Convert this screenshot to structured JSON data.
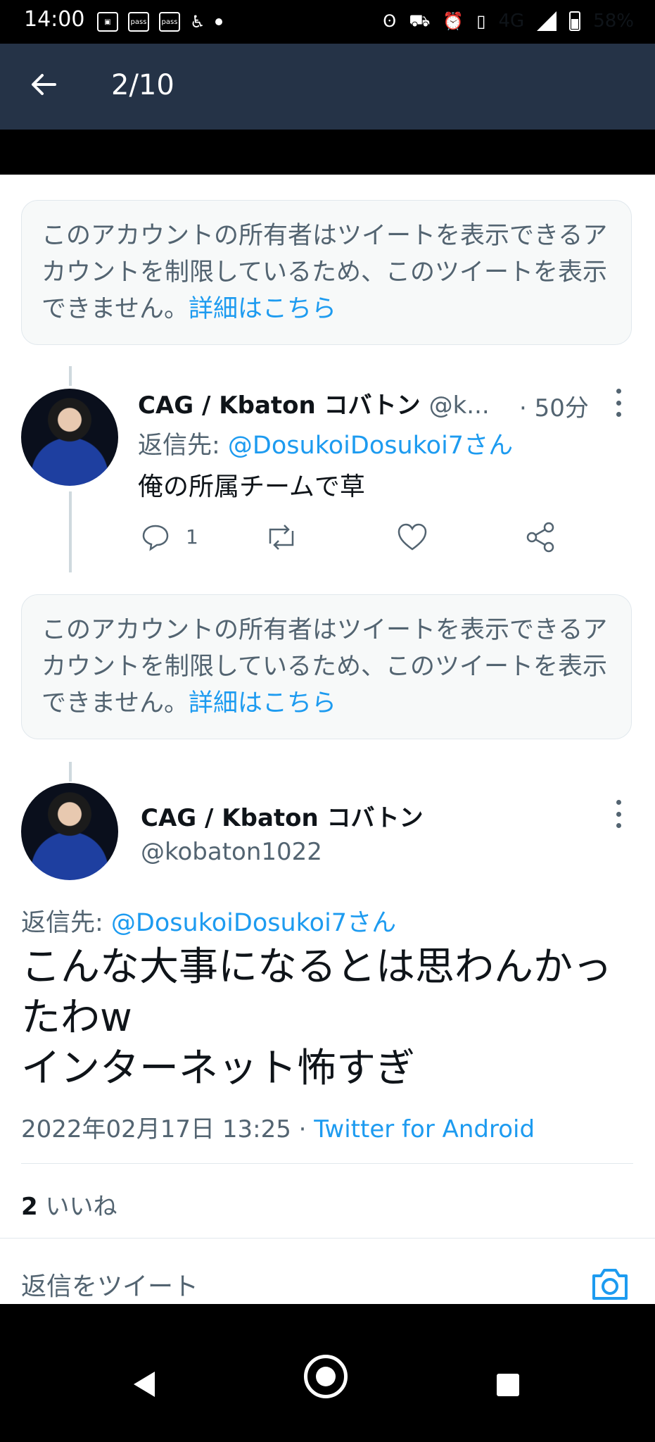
{
  "status_bar": {
    "time": "14:00",
    "left_icons": [
      "image-icon",
      "pass-icon",
      "pass-icon",
      "accessibility-icon"
    ],
    "network": "4G",
    "battery": "58%"
  },
  "app_bar": {
    "title": "2/10"
  },
  "notice": {
    "text": "このアカウントの所有者はツイートを表示できるアカウントを制限しているため、このツイートを表示できません。",
    "link": "詳細はこちら"
  },
  "reply_tweet": {
    "name": "CAG / Kbaton コバトン",
    "handle_truncated": "@k...",
    "time": "· 50分",
    "reply_label": "返信先: ",
    "reply_mention": "@DosukoiDosukoi7さん",
    "text": "俺の所属チームで草",
    "reply_count": "1"
  },
  "main_tweet": {
    "name": "CAG / Kbaton コバトン",
    "handle": "@kobaton1022",
    "reply_label": "返信先: ",
    "reply_mention": "@DosukoiDosukoi7さん",
    "text_line1": "こんな大事になるとは思わんかったわw",
    "text_line2": "インターネット怖すぎ",
    "timestamp": "2022年02月17日 13:25 · ",
    "source": "Twitter for Android",
    "likes_count": "2",
    "likes_label": " いいね"
  },
  "compose": {
    "placeholder": "返信をツイート"
  },
  "colors": {
    "accent": "#1d9bf0",
    "app_bar": "#253347",
    "muted": "#536471"
  }
}
